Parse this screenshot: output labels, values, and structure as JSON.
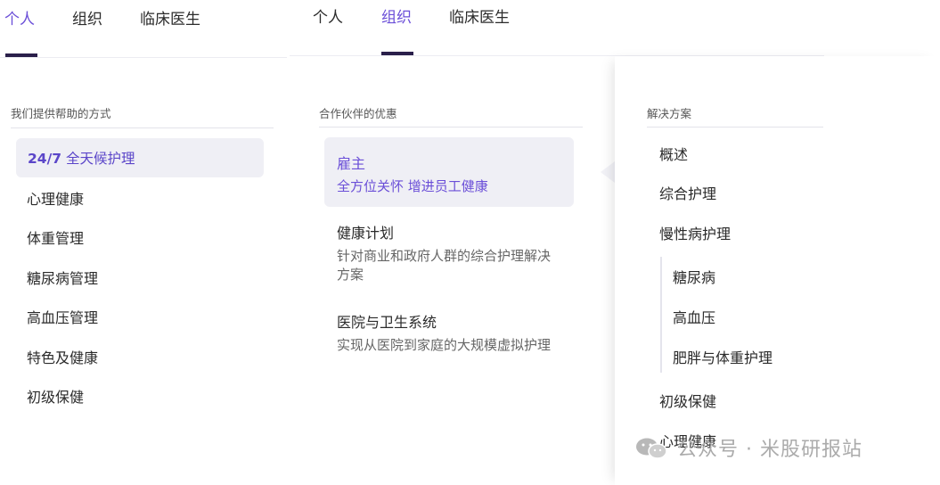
{
  "left_nav": {
    "tabs": [
      "个人",
      "组织",
      "临床医生"
    ],
    "active": 0
  },
  "mid_nav": {
    "tabs": [
      "个人",
      "组织",
      "临床医生"
    ],
    "active": 1
  },
  "left_section": {
    "heading": "我们提供帮助的方式",
    "selected": {
      "bold": "24/7",
      "rest": " 全天候护理"
    },
    "items": [
      "心理健康",
      "体重管理",
      "糖尿病管理",
      "高血压管理",
      "特色及健康",
      "初级保健"
    ]
  },
  "mid_section": {
    "heading": "合作伙伴的优惠",
    "cards": [
      {
        "title": "雇主",
        "desc": "全方位关怀 增进员工健康"
      },
      {
        "title": "健康计划",
        "desc": "针对商业和政府人群的综合护理解决方案"
      },
      {
        "title": "医院与卫生系统",
        "desc": "实现从医院到家庭的大规模虚拟护理"
      }
    ]
  },
  "right_section": {
    "heading": "解决方案",
    "items_top": [
      "概述",
      "综合护理",
      "慢性病护理"
    ],
    "sub_items": [
      "糖尿病",
      "高血压",
      "肥胖与体重护理"
    ],
    "items_bottom": [
      "初级保健",
      "心理健康"
    ]
  },
  "watermark": "公众号 · 米股研报站",
  "colors": {
    "accent": "#6b4fd8",
    "selected_bg": "#efeff5",
    "underline": "#2a1f4a"
  }
}
